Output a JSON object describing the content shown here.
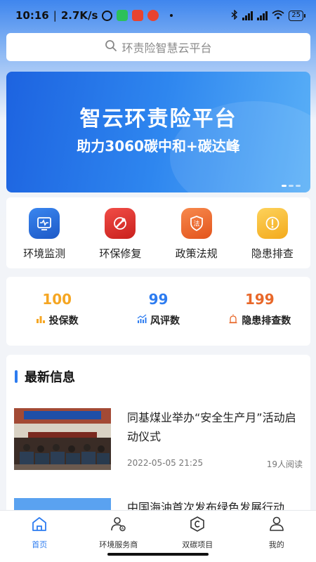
{
  "status": {
    "time": "10:16",
    "net_speed": "2.7K/s",
    "battery": "25"
  },
  "search": {
    "placeholder": "环责险智慧云平台"
  },
  "banner": {
    "title": "智云环责险平台",
    "subtitle": "助力3060碳中和+碳达峰"
  },
  "menu": [
    {
      "label": "环境监测",
      "icon": "monitor-icon",
      "color": "#2a6fe0"
    },
    {
      "label": "环保修复",
      "icon": "repair-icon",
      "color": "#e2312b"
    },
    {
      "label": "政策法规",
      "icon": "law-shield-icon",
      "color": "#ee6a2d"
    },
    {
      "label": "隐患排查",
      "icon": "warning-icon",
      "color": "#f7b92f"
    }
  ],
  "stats": [
    {
      "value": "100",
      "label": "投保数",
      "color": "#f5a623"
    },
    {
      "value": "99",
      "label": "风评数",
      "color": "#2d7cf0"
    },
    {
      "value": "199",
      "label": "隐患排查数",
      "color": "#e8682a"
    }
  ],
  "news": {
    "title": "最新信息",
    "items": [
      {
        "headline": "同基煤业举办“安全生产月”活动启动仪式",
        "date": "2022-05-05 21:25",
        "reads": "19人阅读"
      },
      {
        "headline": "中国海油首次发布绿色发展行动",
        "date": "",
        "reads": ""
      }
    ]
  },
  "nav": [
    {
      "label": "首页",
      "icon": "home-icon",
      "active": true
    },
    {
      "label": "环境服务商",
      "icon": "user-service-icon",
      "active": false
    },
    {
      "label": "双碳项目",
      "icon": "carbon-icon",
      "active": false
    },
    {
      "label": "我的",
      "icon": "profile-icon",
      "active": false
    }
  ]
}
